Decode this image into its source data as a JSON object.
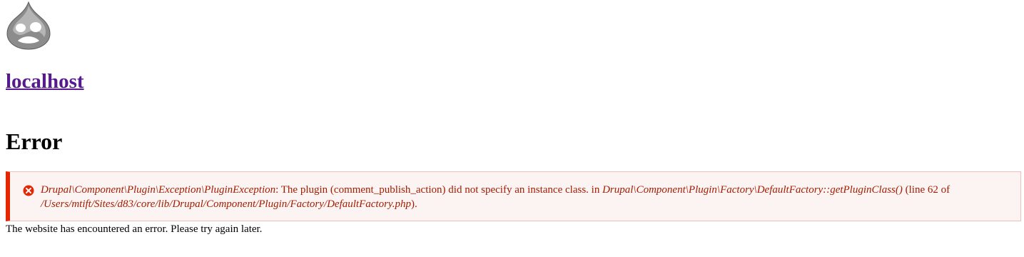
{
  "site": {
    "logo_icon": "drupal-drop-logo-icon",
    "name": "localhost"
  },
  "page": {
    "title": "Error"
  },
  "message": {
    "icon": "error-x-circle-icon",
    "exception_class": "Drupal\\Component\\Plugin\\Exception\\PluginException",
    "text_1": ": The plugin (comment_publish_action) did not specify an instance class. in ",
    "function": "Drupal\\Component\\Plugin\\Factory\\DefaultFactory::getPluginClass()",
    "text_2": " (line ",
    "line_number": "62",
    "text_3": " of ",
    "file_path": "/Users/mtift/Sites/d83/core/lib/Drupal/Component/Plugin/Factory/DefaultFactory.php",
    "text_4": ")."
  },
  "footer": {
    "text": "The website has encountered an error. Please try again later."
  },
  "colors": {
    "link": "#551a8b",
    "error_text": "#a51b00",
    "error_bar": "#e62600",
    "error_bg": "#fcf4f2",
    "error_icon": "#e62600"
  }
}
